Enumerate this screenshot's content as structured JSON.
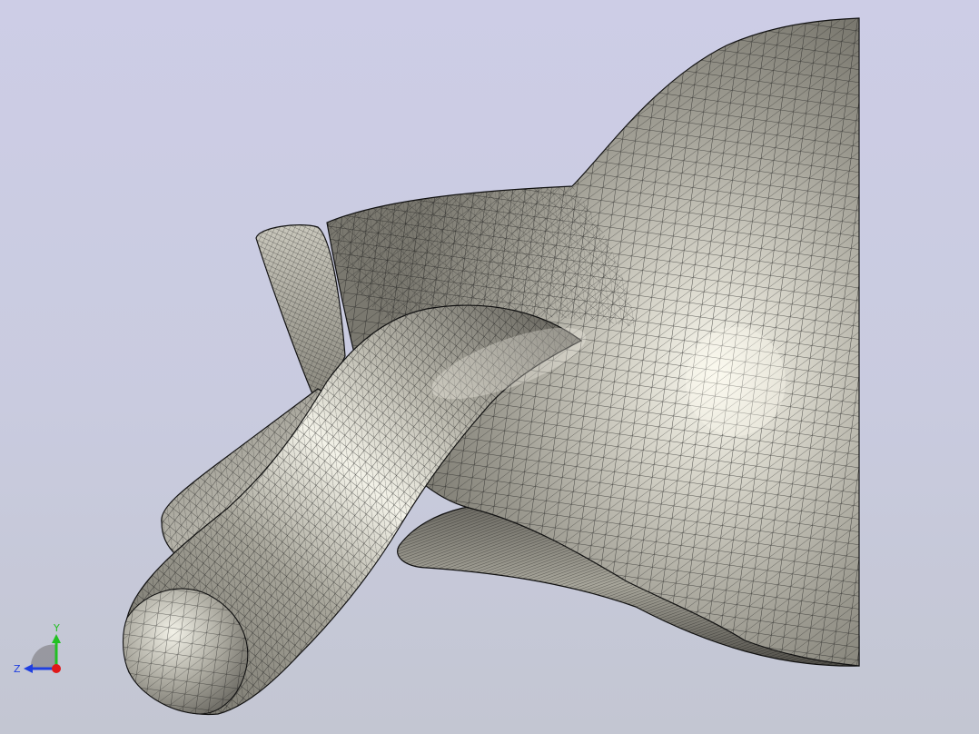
{
  "viewport": {
    "background_top": "#cdcde6",
    "background_bottom": "#c3c6d2",
    "render_mode": "shaded-with-mesh-edges",
    "model": {
      "shade_color": "#9c9a8f",
      "highlight_color": "#f4f3ea",
      "mesh_edge_color": "#1a1a1a"
    }
  },
  "triad": {
    "y_label": "Y",
    "z_label": "Z",
    "y_color": "#22c022",
    "z_color": "#1f3fe0",
    "x_color": "#e01818",
    "icon": "coordinate-triad-icon"
  }
}
